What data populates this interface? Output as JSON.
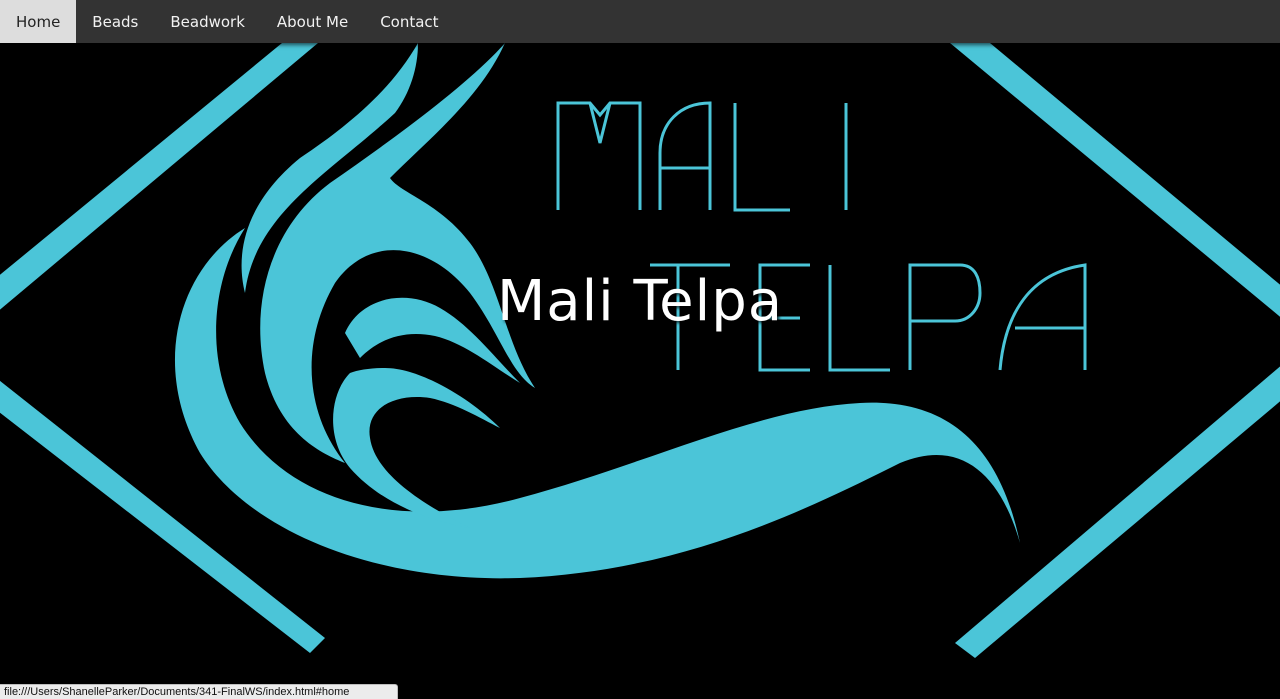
{
  "nav": {
    "items": [
      {
        "label": "Home",
        "active": true
      },
      {
        "label": "Beads",
        "active": false
      },
      {
        "label": "Beadwork",
        "active": false
      },
      {
        "label": "About Me",
        "active": false
      },
      {
        "label": "Contact",
        "active": false
      }
    ]
  },
  "hero": {
    "title": "Mali Telpa",
    "logo_line1": "MALI",
    "logo_line2": "TELPA"
  },
  "status": {
    "url": "file:///Users/ShanelleParker/Documents/341-FinalWS/index.html#home"
  },
  "colors": {
    "accent": "#4bc5d8",
    "nav_bg": "#333333",
    "nav_active_bg": "#dddddd",
    "hero_bg": "#000000"
  }
}
